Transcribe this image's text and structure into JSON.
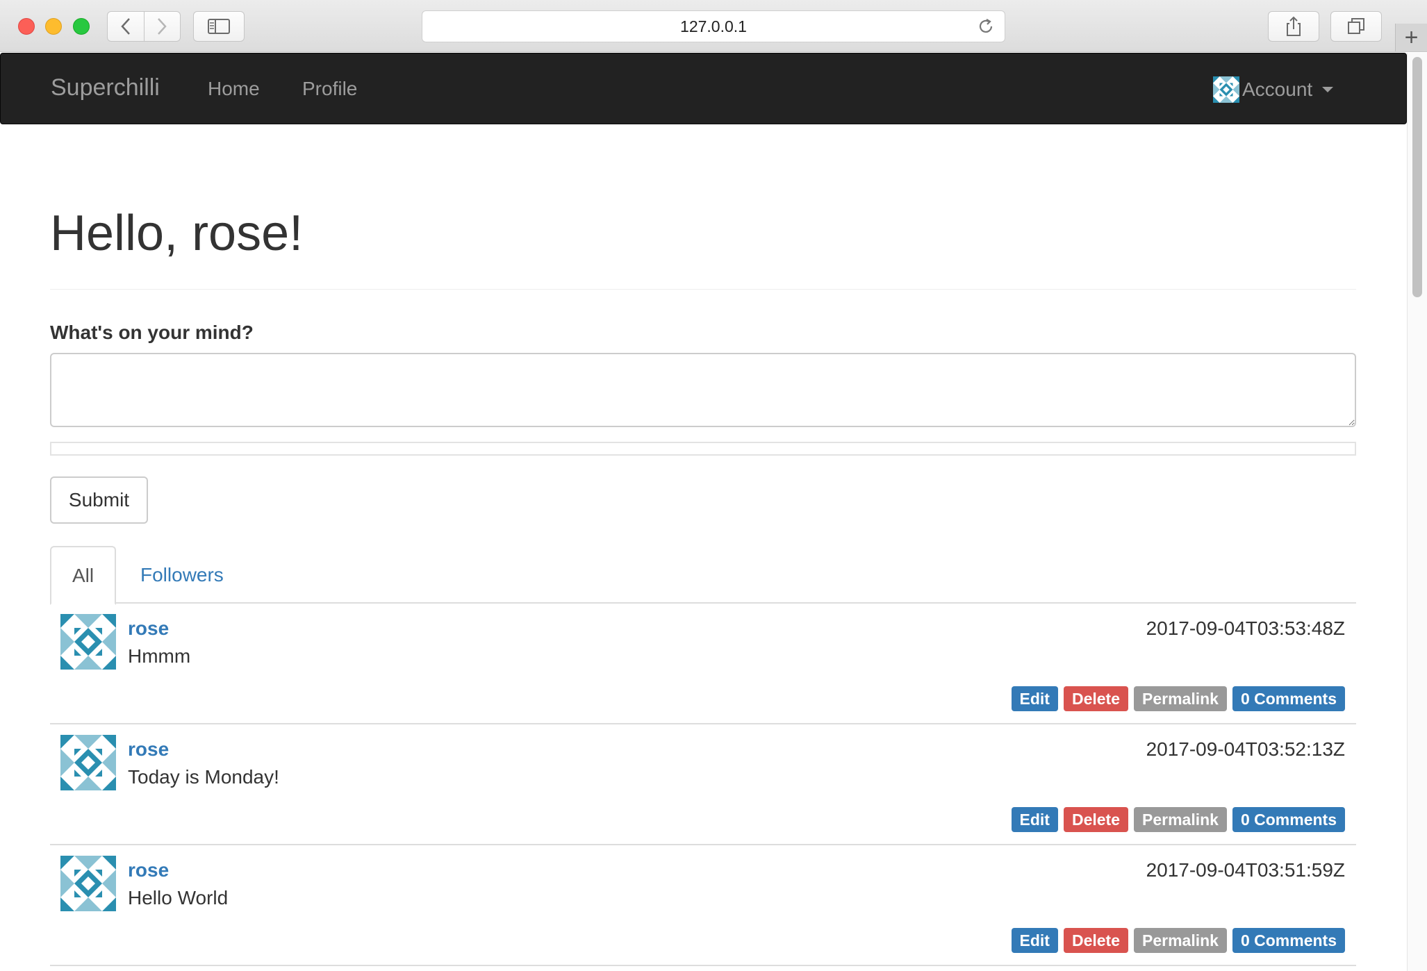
{
  "browser": {
    "url": "127.0.0.1"
  },
  "navbar": {
    "brand": "Superchilli",
    "links": [
      "Home",
      "Profile"
    ],
    "account_label": "Account"
  },
  "page": {
    "title": "Hello, rose!",
    "form_label": "What's on your mind?",
    "textarea_value": "",
    "submit_label": "Submit"
  },
  "tabs": [
    {
      "label": "All",
      "active": true
    },
    {
      "label": "Followers",
      "active": false
    }
  ],
  "posts": [
    {
      "author": "rose",
      "body": "Hmmm",
      "timestamp": "2017-09-04T03:53:48Z",
      "actions": [
        "Edit",
        "Delete",
        "Permalink",
        "0 Comments"
      ]
    },
    {
      "author": "rose",
      "body": "Today is Monday!",
      "timestamp": "2017-09-04T03:52:13Z",
      "actions": [
        "Edit",
        "Delete",
        "Permalink",
        "0 Comments"
      ]
    },
    {
      "author": "rose",
      "body": "Hello World",
      "timestamp": "2017-09-04T03:51:59Z",
      "actions": [
        "Edit",
        "Delete",
        "Permalink",
        "0 Comments"
      ]
    }
  ],
  "colors": {
    "navbar_bg": "#222222",
    "link": "#337ab7",
    "edit": "#337ab7",
    "delete": "#d9534f",
    "permalink": "#999999",
    "comments": "#337ab7",
    "avatar_primary": "#2a8fb0"
  },
  "icons": {
    "back": "chevron-left-icon",
    "forward": "chevron-right-icon",
    "sidebar": "sidebar-icon",
    "reload": "reload-icon",
    "share": "share-icon",
    "tabs": "tabs-icon",
    "new_tab": "plus-icon",
    "avatar": "identicon-avatar"
  }
}
